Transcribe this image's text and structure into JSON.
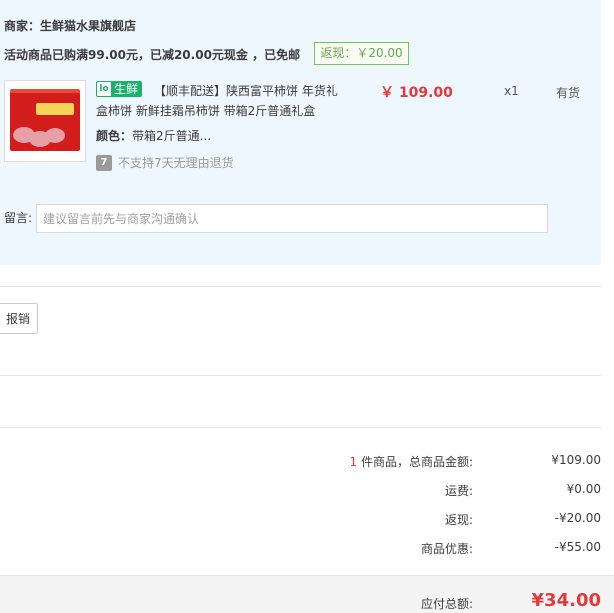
{
  "store": {
    "name": "商家：生鲜猫水果旗舰店",
    "promo": "活动商品已购满99.00元，已减20.00元现金 ，已免邮",
    "rebate_tag": "返现：￥20.00"
  },
  "item": {
    "fresh_icon": "lo",
    "fresh_badge": "生鲜",
    "title": "【顺丰配送】陕西富平柿饼 年货礼盒柿饼 新鲜挂霜吊柿饼 带箱2斤普通礼盒",
    "price": "￥ 109.00",
    "qty": "x1",
    "stock": "有货",
    "color_label": "颜色：",
    "color_value": "带箱2斤普通...",
    "return_icon": "7",
    "return_text": "不支持7天无理由退货"
  },
  "message": {
    "label": "留言:",
    "placeholder": "建议留言前先与商家沟通确认"
  },
  "invoice": {
    "button_label": "报销"
  },
  "summary": {
    "count": "1",
    "count_text": "件商品，总商品金额:",
    "subtotal": "¥109.00",
    "shipping_label": "运费:",
    "shipping": "¥0.00",
    "rebate_label": "返现:",
    "rebate": "-¥20.00",
    "discount_label": "商品优惠:",
    "discount": "-¥55.00",
    "total_label": "应付总额:",
    "total": "¥34.00"
  },
  "colors": {
    "store_bg": "#eef7fe",
    "price_red": "#e4393c",
    "fresh_green": "#19b16b",
    "rebate_green": "#6ca350"
  }
}
